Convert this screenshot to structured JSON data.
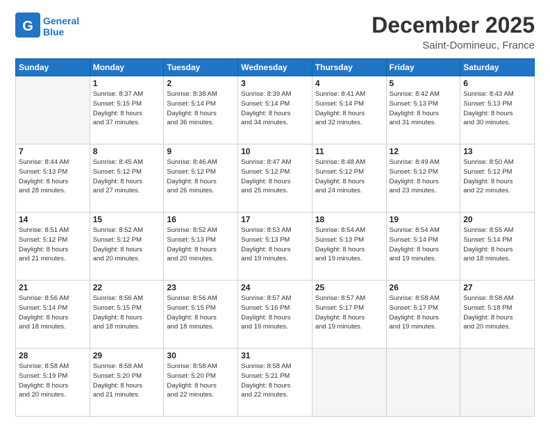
{
  "header": {
    "logo_general": "General",
    "logo_blue": "Blue",
    "month": "December 2025",
    "location": "Saint-Domineuc, France"
  },
  "days_of_week": [
    "Sunday",
    "Monday",
    "Tuesday",
    "Wednesday",
    "Thursday",
    "Friday",
    "Saturday"
  ],
  "weeks": [
    [
      {
        "day": "",
        "info": ""
      },
      {
        "day": "1",
        "info": "Sunrise: 8:37 AM\nSunset: 5:15 PM\nDaylight: 8 hours\nand 37 minutes."
      },
      {
        "day": "2",
        "info": "Sunrise: 8:38 AM\nSunset: 5:14 PM\nDaylight: 8 hours\nand 36 minutes."
      },
      {
        "day": "3",
        "info": "Sunrise: 8:39 AM\nSunset: 5:14 PM\nDaylight: 8 hours\nand 34 minutes."
      },
      {
        "day": "4",
        "info": "Sunrise: 8:41 AM\nSunset: 5:14 PM\nDaylight: 8 hours\nand 32 minutes."
      },
      {
        "day": "5",
        "info": "Sunrise: 8:42 AM\nSunset: 5:13 PM\nDaylight: 8 hours\nand 31 minutes."
      },
      {
        "day": "6",
        "info": "Sunrise: 8:43 AM\nSunset: 5:13 PM\nDaylight: 8 hours\nand 30 minutes."
      }
    ],
    [
      {
        "day": "7",
        "info": "Sunrise: 8:44 AM\nSunset: 5:13 PM\nDaylight: 8 hours\nand 28 minutes."
      },
      {
        "day": "8",
        "info": "Sunrise: 8:45 AM\nSunset: 5:12 PM\nDaylight: 8 hours\nand 27 minutes."
      },
      {
        "day": "9",
        "info": "Sunrise: 8:46 AM\nSunset: 5:12 PM\nDaylight: 8 hours\nand 26 minutes."
      },
      {
        "day": "10",
        "info": "Sunrise: 8:47 AM\nSunset: 5:12 PM\nDaylight: 8 hours\nand 25 minutes."
      },
      {
        "day": "11",
        "info": "Sunrise: 8:48 AM\nSunset: 5:12 PM\nDaylight: 8 hours\nand 24 minutes."
      },
      {
        "day": "12",
        "info": "Sunrise: 8:49 AM\nSunset: 5:12 PM\nDaylight: 8 hours\nand 23 minutes."
      },
      {
        "day": "13",
        "info": "Sunrise: 8:50 AM\nSunset: 5:12 PM\nDaylight: 8 hours\nand 22 minutes."
      }
    ],
    [
      {
        "day": "14",
        "info": "Sunrise: 8:51 AM\nSunset: 5:12 PM\nDaylight: 8 hours\nand 21 minutes."
      },
      {
        "day": "15",
        "info": "Sunrise: 8:52 AM\nSunset: 5:12 PM\nDaylight: 8 hours\nand 20 minutes."
      },
      {
        "day": "16",
        "info": "Sunrise: 8:52 AM\nSunset: 5:13 PM\nDaylight: 8 hours\nand 20 minutes."
      },
      {
        "day": "17",
        "info": "Sunrise: 8:53 AM\nSunset: 5:13 PM\nDaylight: 8 hours\nand 19 minutes."
      },
      {
        "day": "18",
        "info": "Sunrise: 8:54 AM\nSunset: 5:13 PM\nDaylight: 8 hours\nand 19 minutes."
      },
      {
        "day": "19",
        "info": "Sunrise: 8:54 AM\nSunset: 5:14 PM\nDaylight: 8 hours\nand 19 minutes."
      },
      {
        "day": "20",
        "info": "Sunrise: 8:55 AM\nSunset: 5:14 PM\nDaylight: 8 hours\nand 18 minutes."
      }
    ],
    [
      {
        "day": "21",
        "info": "Sunrise: 8:56 AM\nSunset: 5:14 PM\nDaylight: 8 hours\nand 18 minutes."
      },
      {
        "day": "22",
        "info": "Sunrise: 8:56 AM\nSunset: 5:15 PM\nDaylight: 8 hours\nand 18 minutes."
      },
      {
        "day": "23",
        "info": "Sunrise: 8:56 AM\nSunset: 5:15 PM\nDaylight: 8 hours\nand 18 minutes."
      },
      {
        "day": "24",
        "info": "Sunrise: 8:57 AM\nSunset: 5:16 PM\nDaylight: 8 hours\nand 19 minutes."
      },
      {
        "day": "25",
        "info": "Sunrise: 8:57 AM\nSunset: 5:17 PM\nDaylight: 8 hours\nand 19 minutes."
      },
      {
        "day": "26",
        "info": "Sunrise: 8:58 AM\nSunset: 5:17 PM\nDaylight: 8 hours\nand 19 minutes."
      },
      {
        "day": "27",
        "info": "Sunrise: 8:58 AM\nSunset: 5:18 PM\nDaylight: 8 hours\nand 20 minutes."
      }
    ],
    [
      {
        "day": "28",
        "info": "Sunrise: 8:58 AM\nSunset: 5:19 PM\nDaylight: 8 hours\nand 20 minutes."
      },
      {
        "day": "29",
        "info": "Sunrise: 8:58 AM\nSunset: 5:20 PM\nDaylight: 8 hours\nand 21 minutes."
      },
      {
        "day": "30",
        "info": "Sunrise: 8:58 AM\nSunset: 5:20 PM\nDaylight: 8 hours\nand 22 minutes."
      },
      {
        "day": "31",
        "info": "Sunrise: 8:58 AM\nSunset: 5:21 PM\nDaylight: 8 hours\nand 22 minutes."
      },
      {
        "day": "",
        "info": ""
      },
      {
        "day": "",
        "info": ""
      },
      {
        "day": "",
        "info": ""
      }
    ]
  ]
}
